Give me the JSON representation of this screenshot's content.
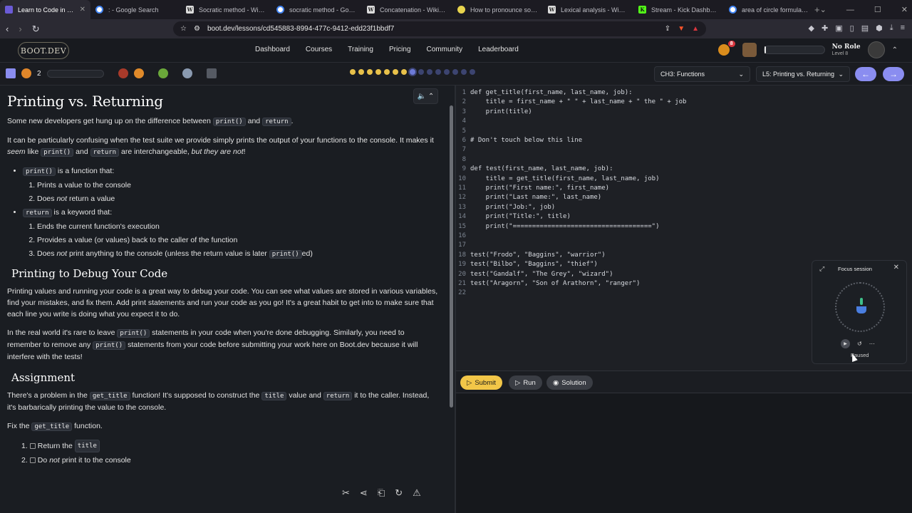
{
  "browser": {
    "tabs": [
      {
        "title": "Learn to Code in Pyth",
        "icon": "bootdev-icon"
      },
      {
        "title": ": - Google Search",
        "icon": "google-icon"
      },
      {
        "title": "Socratic method - Wikipe",
        "icon": "wikipedia-icon"
      },
      {
        "title": "socratic method - Google",
        "icon": "google-icon"
      },
      {
        "title": "Concatenation - Wikipedia",
        "icon": "wikipedia-icon"
      },
      {
        "title": "How to pronounce socrat",
        "icon": "page-icon"
      },
      {
        "title": "Lexical analysis - Wikipedi",
        "icon": "wikipedia-icon"
      },
      {
        "title": "Stream - Kick Dashboard",
        "icon": "kick-icon"
      },
      {
        "title": "area of circle formula visu",
        "icon": "google-icon"
      }
    ],
    "url": "boot.dev/lessons/cd545883-8994-477c-9412-edd23f1bbdf7"
  },
  "site": {
    "logo": "BOOT.DEV",
    "nav": [
      "Dashboard",
      "Courses",
      "Training",
      "Pricing",
      "Community",
      "Leaderboard"
    ],
    "notification_count": "8",
    "xp_fill": 0.03,
    "role": "No Role",
    "level": "Level 8"
  },
  "lessonbar": {
    "streak": "2",
    "chapter": "CH3: Functions",
    "lesson": "L5: Printing vs. Returning",
    "lesson_dots": 15,
    "current_dot": 7
  },
  "lesson": {
    "title": "Printing vs. Returning",
    "intro_pre": "Some new developers get hung up on the difference between ",
    "intro_code1": "print()",
    "intro_and": " and ",
    "intro_code2": "return",
    "intro_end": ".",
    "p2_a": "It can be particularly confusing when the test suite we provide simply prints the output of your functions to the console. It makes it ",
    "p2_em": "seem",
    "p2_b": " like ",
    "p2_code1": "print()",
    "p2_c": " and ",
    "p2_code2": "return",
    "p2_d": " are interchangeable, ",
    "p2_em2": "but they are not",
    "p2_e": "!",
    "b1_code": "print()",
    "b1_text": " is a function that:",
    "b1_items": [
      "Prints a value to the console",
      "Does ",
      "not",
      " return a value"
    ],
    "b2_code": "return",
    "b2_text": " is a keyword that:",
    "b2_item1": "Ends the current function's execution",
    "b2_item2": "Provides a value (or values) back to the caller of the function",
    "b2_item3_a": "Does ",
    "b2_item3_em": "not",
    "b2_item3_b": " print anything to the console (unless the return value is later ",
    "b2_item3_code": "print()",
    "b2_item3_c": "ed)",
    "h2_debug": "Printing to Debug Your Code",
    "debug_p1": "Printing values and running your code is a great way to debug your code. You can see what values are stored in various variables, find your mistakes, and fix them. Add print statements and run your code as you go! It's a great habit to get into to make sure that each line you write is doing what you expect it to do.",
    "debug_p2_a": "In the real world it's rare to leave ",
    "debug_p2_code1": "print()",
    "debug_p2_b": " statements in your code when you're done debugging. Similarly, you need to remember to remove any ",
    "debug_p2_code2": "print()",
    "debug_p2_c": " statements from your code before submitting your work here on Boot.dev because it will interfere with the tests!",
    "h2_assign": "Assignment",
    "assign_a": "There's a problem in the ",
    "assign_code1": "get_title",
    "assign_b": " function! It's supposed to construct the ",
    "assign_code2": "title",
    "assign_c": " value and ",
    "assign_code3": "return",
    "assign_d": " it to the caller. Instead, it's barbarically printing the value to the console.",
    "fix_a": "Fix the ",
    "fix_code": "get_title",
    "fix_b": " function.",
    "task1_a": "Return the ",
    "task1_code": "title",
    "task2_a": "Do ",
    "task2_em": "not",
    "task2_b": " print it to the console"
  },
  "editor": {
    "lines": [
      "def get_title(first_name, last_name, job):",
      "    title = first_name + \" \" + last_name + \" the \" + job",
      "    print(title)",
      "",
      "",
      "# Don't touch below this line",
      "",
      "",
      "def test(first_name, last_name, job):",
      "    title = get_title(first_name, last_name, job)",
      "    print(\"First name:\", first_name)",
      "    print(\"Last name:\", last_name)",
      "    print(\"Job:\", job)",
      "    print(\"Title:\", title)",
      "    print(\"====================================\")",
      "",
      "",
      "test(\"Frodo\", \"Baggins\", \"warrior\")",
      "test(\"Bilbo\", \"Baggins\", \"thief\")",
      "test(\"Gandalf\", \"The Grey\", \"wizard\")",
      "test(\"Aragorn\", \"Son of Arathorn\", \"ranger\")",
      ""
    ]
  },
  "actions": {
    "submit": "Submit",
    "run": "Run",
    "solution": "Solution"
  },
  "focus": {
    "title": "Focus session",
    "status": "Paused"
  },
  "colors": {
    "accent": "#8a8df0",
    "submit": "#f2c648",
    "background": "#1a1d22"
  }
}
